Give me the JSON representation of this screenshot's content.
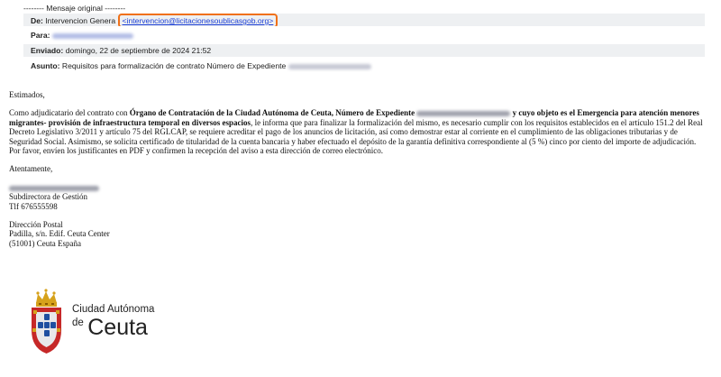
{
  "header": {
    "original_label": "-------- Mensaje original --------",
    "from_label": "De:",
    "from_name": "Intervencion Genera",
    "from_email": "<intervencion@licitacionesoublicasgob.org>",
    "to_label": "Para:",
    "sent_label": "Enviado:",
    "sent_value": "domingo, 22 de septiembre de 2024 21:52",
    "subject_label": "Asunto:",
    "subject_value": "Requisitos para formalización de contrato Número de Expediente"
  },
  "body": {
    "greeting": "Estimados,",
    "p1_a": "Como adjudicatario del contrato con ",
    "p1_b": "Órgano de Contratación de la Ciudad Autónoma de Ceuta, Número de Expediente",
    "p1_c": "y cuyo objeto es el Emergencia para atención menores migrantes- provisión de infraestructura temporal en diversos espacios",
    "p1_d": ", le informa que para finalizar la formalización del mismo, es necesario cumplir con los requisitos establecidos en el artículo 151.2 del Real Decreto Legislativo 3/2011 y artículo 75 del RGLCAP, se requiere acreditar el pago de los anuncios de licitación, así como demostrar estar al corriente en el cumplimiento de las obligaciones tributarias y de Seguridad Social. Asimismo, se solicita certificado de titularidad de la cuenta bancaria y haber efectuado el depósito de la garantía definitiva correspondiente al (5 %) cinco por ciento del importe de adjudicación.",
    "p2": "Por favor, envíen los justificantes en PDF y confirmen la recepción del aviso a esta dirección de correo electrónico.",
    "closing": "Atentamente,",
    "role": "Subdirectora de Gestión",
    "phone": "Tlf 676555598",
    "address_title": "Dirección Postal",
    "address_line1": "Padilla, s/n. Edif. Ceuta Center",
    "address_line2": "(51001) Ceuta España"
  },
  "logo": {
    "line1": "Ciudad Autónoma",
    "de": "de",
    "city": "Ceuta",
    "colors": {
      "crown": "#d6a21c",
      "shield_red": "#c62828",
      "shield_blue": "#1f4fa0",
      "shield_silver": "#e8e8ea"
    }
  }
}
